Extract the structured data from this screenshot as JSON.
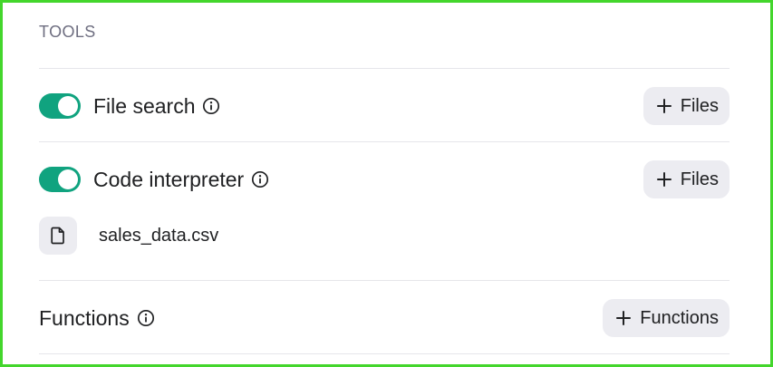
{
  "section": {
    "title": "TOOLS"
  },
  "tools": {
    "file_search": {
      "label": "File search",
      "enabled": true,
      "button_label": "Files"
    },
    "code_interpreter": {
      "label": "Code interpreter",
      "enabled": true,
      "button_label": "Files",
      "files": [
        {
          "name": "sales_data.csv",
          "icon": "file-icon"
        }
      ]
    },
    "functions": {
      "label": "Functions",
      "button_label": "Functions"
    }
  },
  "colors": {
    "toggle_on": "#10a37f",
    "button_bg": "#ececf1",
    "frame_border": "#43d62c",
    "muted_text": "#6e6e80"
  }
}
